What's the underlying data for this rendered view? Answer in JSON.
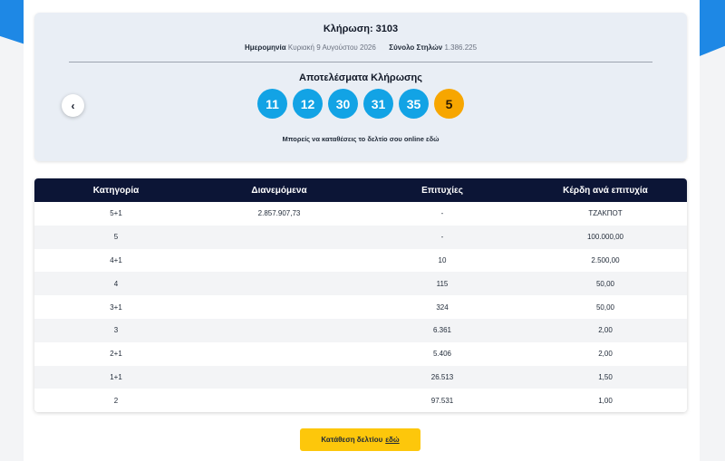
{
  "draw": {
    "title": "Κλήρωση: 3103",
    "date_label": "Ημερομηνία",
    "date_value": "Κυριακή 9 Αυγούστου 2026",
    "columns_label": "Σύνολο Στηλών",
    "columns_value": "1.386.225",
    "results_title": "Αποτελέσματα Κλήρωσης",
    "numbers": [
      "11",
      "12",
      "30",
      "31",
      "35"
    ],
    "bonus": "5",
    "online_note": "Μπορείς να καταθέσεις το δελτίο σου online εδώ",
    "prev_icon": "‹"
  },
  "table": {
    "headers": [
      "Κατηγορία",
      "Διανεμόμενα",
      "Επιτυχίες",
      "Κέρδη ανά επιτυχία"
    ],
    "rows": [
      [
        "5+1",
        "2.857.907,73",
        "-",
        "ΤΖΑΚΠΟΤ"
      ],
      [
        "5",
        "",
        "-",
        "100.000,00"
      ],
      [
        "4+1",
        "",
        "10",
        "2.500,00"
      ],
      [
        "4",
        "",
        "115",
        "50,00"
      ],
      [
        "3+1",
        "",
        "324",
        "50,00"
      ],
      [
        "3",
        "",
        "6.361",
        "2,00"
      ],
      [
        "2+1",
        "",
        "5.406",
        "2,00"
      ],
      [
        "1+1",
        "",
        "26.513",
        "1,50"
      ],
      [
        "2",
        "",
        "97.531",
        "1,00"
      ]
    ]
  },
  "submit": {
    "label": "Κατάθεση δελτίου",
    "link": "εδώ"
  },
  "colors": {
    "accent_blue": "#12a3e5",
    "bonus_orange": "#f7a600",
    "header_navy": "#0c1536",
    "button_yellow": "#fdc70b"
  }
}
